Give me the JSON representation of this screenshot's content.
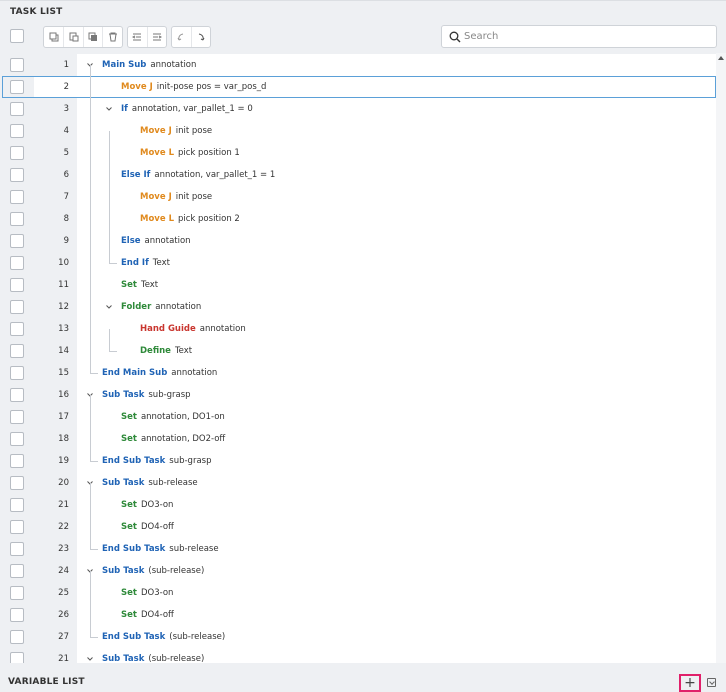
{
  "panel": {
    "title": "TASK LIST"
  },
  "search": {
    "placeholder": "Search",
    "value": ""
  },
  "toolbar": {
    "edit_icons": [
      "copy-icon",
      "paste-icon",
      "duplicate-icon",
      "delete-icon"
    ],
    "indent_icons": [
      "outdent-icon",
      "indent-icon"
    ],
    "history_icons": [
      "undo-icon",
      "redo-icon"
    ]
  },
  "colors": {
    "blue": "#1f63b5",
    "orange": "#e08a1e",
    "green": "#2f8a3a",
    "red": "#c9362f",
    "selection": "#5ba0d8",
    "highlight": "#e0206a"
  },
  "rows": [
    {
      "num": "1",
      "depth": 0,
      "chevron": true,
      "kw": "Main Sub",
      "color": "blue",
      "args": "annotation"
    },
    {
      "num": "2",
      "depth": 1,
      "chevron": false,
      "kw": "Move J",
      "color": "orange",
      "args": "init-pose   pos = var_pos_d",
      "selected": true
    },
    {
      "num": "3",
      "depth": 1,
      "chevron": true,
      "kw": "If",
      "color": "blue",
      "args": "annotation,   var_pallet_1 = 0"
    },
    {
      "num": "4",
      "depth": 2,
      "chevron": false,
      "kw": "Move J",
      "color": "orange",
      "args": "init pose"
    },
    {
      "num": "5",
      "depth": 2,
      "chevron": false,
      "kw": "Move L",
      "color": "orange",
      "args": "pick position 1"
    },
    {
      "num": "6",
      "depth": 1,
      "chevron": false,
      "kw": "Else If",
      "color": "blue",
      "args": "annotation,   var_pallet_1 = 1"
    },
    {
      "num": "7",
      "depth": 2,
      "chevron": false,
      "kw": "Move J",
      "color": "orange",
      "args": "init pose"
    },
    {
      "num": "8",
      "depth": 2,
      "chevron": false,
      "kw": "Move L",
      "color": "orange",
      "args": "pick position 2"
    },
    {
      "num": "9",
      "depth": 1,
      "chevron": false,
      "kw": "Else",
      "color": "blue",
      "args": "annotation"
    },
    {
      "num": "10",
      "depth": 1,
      "chevron": false,
      "kw": "End If",
      "color": "blue",
      "args": "Text"
    },
    {
      "num": "11",
      "depth": 1,
      "chevron": false,
      "kw": "Set",
      "color": "green",
      "args": "Text"
    },
    {
      "num": "12",
      "depth": 1,
      "chevron": true,
      "kw": "Folder",
      "color": "green",
      "args": "annotation"
    },
    {
      "num": "13",
      "depth": 2,
      "chevron": false,
      "kw": "Hand Guide",
      "color": "red",
      "args": "annotation"
    },
    {
      "num": "14",
      "depth": 2,
      "chevron": false,
      "kw": "Define",
      "color": "green",
      "args": "Text"
    },
    {
      "num": "15",
      "depth": 0,
      "chevron": false,
      "kw": "End Main Sub",
      "color": "blue",
      "args": "annotation"
    },
    {
      "num": "16",
      "depth": 0,
      "chevron": true,
      "kw": "Sub Task",
      "color": "blue",
      "args": "sub-grasp"
    },
    {
      "num": "17",
      "depth": 1,
      "chevron": false,
      "kw": "Set",
      "color": "green",
      "args": "annotation,   DO1-on"
    },
    {
      "num": "18",
      "depth": 1,
      "chevron": false,
      "kw": "Set",
      "color": "green",
      "args": "annotation,   DO2-off"
    },
    {
      "num": "19",
      "depth": 0,
      "chevron": false,
      "kw": "End Sub Task",
      "color": "blue",
      "args": "sub-grasp"
    },
    {
      "num": "20",
      "depth": 0,
      "chevron": true,
      "kw": "Sub Task",
      "color": "blue",
      "args": "sub-release"
    },
    {
      "num": "21",
      "depth": 1,
      "chevron": false,
      "kw": "Set",
      "color": "green",
      "args": "DO3-on"
    },
    {
      "num": "22",
      "depth": 1,
      "chevron": false,
      "kw": "Set",
      "color": "green",
      "args": "DO4-off"
    },
    {
      "num": "23",
      "depth": 0,
      "chevron": false,
      "kw": "End Sub Task",
      "color": "blue",
      "args": "sub-release"
    },
    {
      "num": "24",
      "depth": 0,
      "chevron": true,
      "kw": "Sub Task",
      "color": "blue",
      "args": "(sub-release)"
    },
    {
      "num": "25",
      "depth": 1,
      "chevron": false,
      "kw": "Set",
      "color": "green",
      "args": "DO3-on"
    },
    {
      "num": "26",
      "depth": 1,
      "chevron": false,
      "kw": "Set",
      "color": "green",
      "args": "DO4-off"
    },
    {
      "num": "27",
      "depth": 0,
      "chevron": false,
      "kw": "End Sub Task",
      "color": "blue",
      "args": "(sub-release)"
    },
    {
      "num": "21",
      "depth": 0,
      "chevron": true,
      "kw": "Sub Task",
      "color": "blue",
      "args": "(sub-release)"
    }
  ],
  "footer": {
    "title": "VARIABLE LIST",
    "add_label": "+"
  }
}
